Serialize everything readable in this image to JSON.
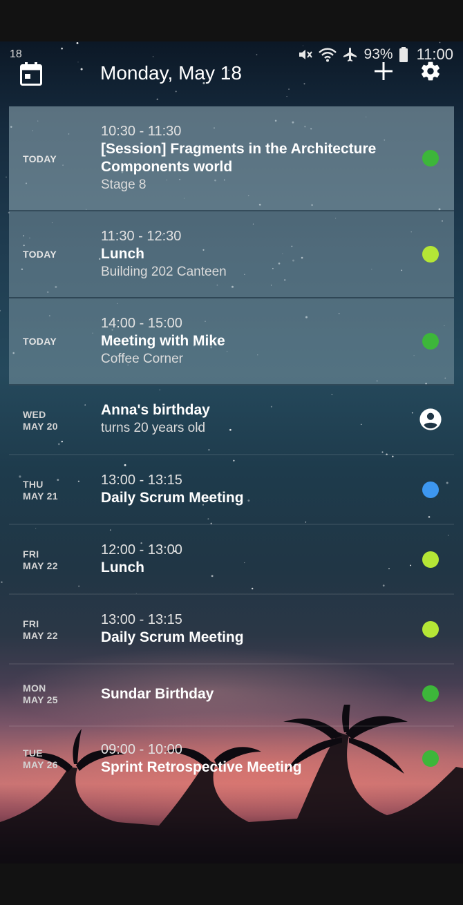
{
  "status_bar": {
    "notification": "18",
    "battery": "93%",
    "time": "11:00",
    "icons": [
      "mute-icon",
      "wifi-icon",
      "airplane-icon",
      "battery-icon"
    ]
  },
  "header": {
    "title": "Monday, May 18",
    "calendar_icon": "calendar-icon",
    "add_icon": "plus-icon",
    "settings_icon": "gear-icon"
  },
  "colors": {
    "green": "#3db63a",
    "lime": "#b5e636",
    "blue": "#3d97f0"
  },
  "events": [
    {
      "day": "TODAY",
      "date": "",
      "time": "10:30 - 11:30",
      "title": "[Session] Fragments in the Architecture Components world",
      "location": "Stage 8",
      "indicator": "dot",
      "color": "#3db63a"
    },
    {
      "day": "TODAY",
      "date": "",
      "time": "11:30 - 12:30",
      "title": "Lunch",
      "location": "Building 202 Canteen",
      "indicator": "dot",
      "color": "#b5e636"
    },
    {
      "day": "TODAY",
      "date": "",
      "time": "14:00 - 15:00",
      "title": "Meeting with Mike",
      "location": "Coffee Corner",
      "indicator": "dot",
      "color": "#3db63a"
    },
    {
      "day": "WED",
      "date": "MAY 20",
      "time": "",
      "title": "Anna's birthday",
      "location": "turns 20 years old",
      "indicator": "person-icon",
      "color": "#ffffff"
    },
    {
      "day": "THU",
      "date": "MAY 21",
      "time": "13:00 - 13:15",
      "title": "Daily Scrum Meeting",
      "location": "",
      "indicator": "dot",
      "color": "#3d97f0"
    },
    {
      "day": "FRI",
      "date": "MAY 22",
      "time": "12:00 - 13:00",
      "title": "Lunch",
      "location": "",
      "indicator": "dot",
      "color": "#b5e636"
    },
    {
      "day": "FRI",
      "date": "MAY 22",
      "time": "13:00 - 13:15",
      "title": "Daily Scrum Meeting",
      "location": "",
      "indicator": "dot",
      "color": "#b5e636"
    },
    {
      "day": "MON",
      "date": "MAY 25",
      "time": "",
      "title": "Sundar Birthday",
      "location": "",
      "indicator": "dot",
      "color": "#3db63a"
    },
    {
      "day": "TUE",
      "date": "MAY 26",
      "time": "09:00 - 10:00",
      "title": "Sprint Retrospective Meeting",
      "location": "",
      "indicator": "dot",
      "color": "#3db63a"
    }
  ]
}
